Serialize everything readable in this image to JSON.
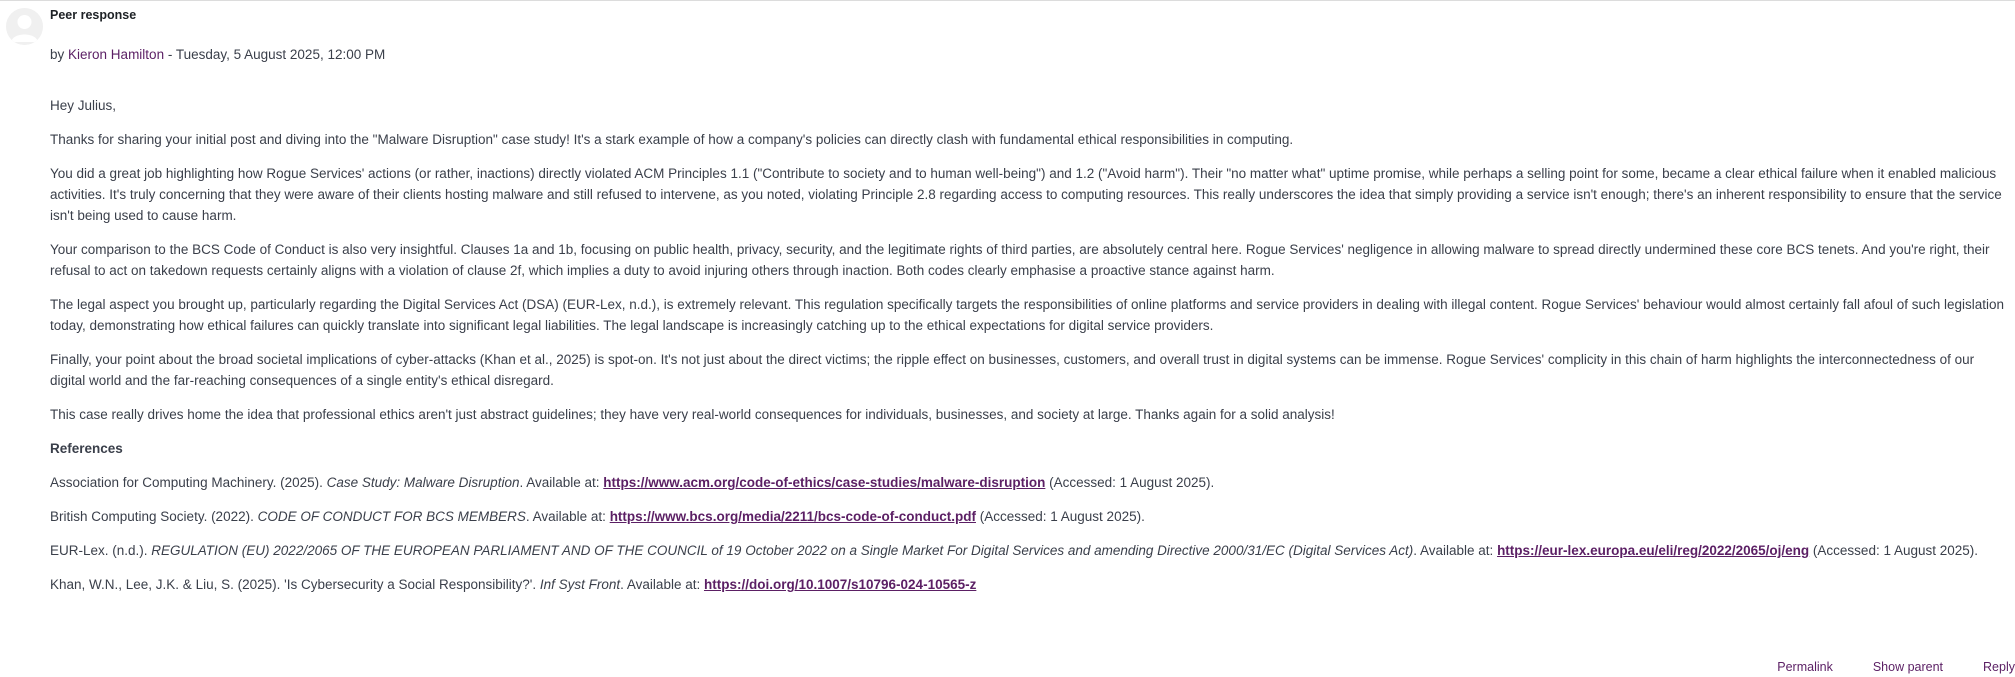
{
  "post": {
    "subject": "Peer response",
    "byline_prefix": "by",
    "author": "Kieron Hamilton",
    "date": "- Tuesday, 5 August 2025, 12:00 PM",
    "paragraphs": [
      "Hey Julius,",
      "Thanks for sharing your initial post and diving into the \"Malware Disruption\" case study! It's a stark example of how a company's policies can directly clash with fundamental ethical responsibilities in computing.",
      "You did a great job highlighting how Rogue Services' actions (or rather, inactions) directly violated ACM Principles 1.1 (\"Contribute to society and to human well-being\") and 1.2 (\"Avoid harm\"). Their \"no matter what\" uptime promise, while perhaps a selling point for some, became a clear ethical failure when it enabled malicious activities. It's truly concerning that they were aware of their clients hosting malware and still refused to intervene, as you noted, violating Principle 2.8 regarding access to computing resources. This really underscores the idea that simply providing a service isn't enough; there's an inherent responsibility to ensure that the service isn't being used to cause harm.",
      "Your comparison to the BCS Code of Conduct is also very insightful. Clauses 1a and 1b, focusing on public health, privacy, security, and the legitimate rights of third parties, are absolutely central here. Rogue Services' negligence in allowing malware to spread directly undermined these core BCS tenets. And you're right, their refusal to act on takedown requests certainly aligns with a violation of clause 2f, which implies a duty to avoid injuring others through inaction. Both codes clearly emphasise a proactive stance against harm.",
      "The legal aspect you brought up, particularly regarding the Digital Services Act (DSA) (EUR-Lex, n.d.), is extremely relevant. This regulation specifically targets the responsibilities of online platforms and service providers in dealing with illegal content. Rogue Services' behaviour would almost certainly fall afoul of such legislation today, demonstrating how ethical failures can quickly translate into significant legal liabilities. The legal landscape is increasingly catching up to the ethical expectations for digital service providers.",
      "Finally, your point about the broad societal implications of cyber-attacks (Khan et al., 2025) is spot-on. It's not just about the direct victims; the ripple effect on businesses, customers, and overall trust in digital systems can be immense. Rogue Services' complicity in this chain of harm highlights the interconnectedness of our digital world and the far-reaching consequences of a single entity's ethical disregard.",
      "This case really drives home the idea that professional ethics aren't just abstract guidelines; they have very real-world consequences for individuals, businesses, and society at large. Thanks again for a solid analysis!"
    ],
    "references_heading": "References",
    "references": [
      {
        "before": "Association for Computing Machinery. (2025). ",
        "italic": "Case Study: Malware Disruption",
        "middle": ". Available at: ",
        "link": "https://www.acm.org/code-of-ethics/case-studies/malware-disruption",
        "after": " (Accessed: 1 August 2025)."
      },
      {
        "before": "British Computing Society. (2022). ",
        "italic": "CODE OF CONDUCT FOR BCS MEMBERS",
        "middle": ". Available at: ",
        "link": "https://www.bcs.org/media/2211/bcs-code-of-conduct.pdf",
        "after": " (Accessed: 1 August 2025)."
      },
      {
        "before": "EUR-Lex. (n.d.). ",
        "italic": "REGULATION (EU) 2022/2065 OF THE EUROPEAN PARLIAMENT AND OF THE COUNCIL of 19 October 2022 on a Single Market For Digital Services and amending Directive 2000/31/EC (Digital Services Act)",
        "middle": ". Available at: ",
        "link": "https://eur-lex.europa.eu/eli/reg/2022/2065/oj/eng",
        "after": " (Accessed: 1 August 2025)."
      },
      {
        "before": "Khan, W.N., Lee, J.K. & Liu, S. (2025). 'Is Cybersecurity a Social Responsibility?'. ",
        "italic": "Inf Syst Front",
        "middle": ". Available at: ",
        "link": "https://doi.org/10.1007/s10796-024-10565-z",
        "after": ""
      }
    ]
  },
  "footer": {
    "permalink": "Permalink",
    "show_parent": "Show parent",
    "reply": "Reply"
  },
  "icons": {
    "avatar": "user-avatar-icon"
  },
  "colors": {
    "link": "#5b1f64",
    "text": "#3a3f4a"
  }
}
